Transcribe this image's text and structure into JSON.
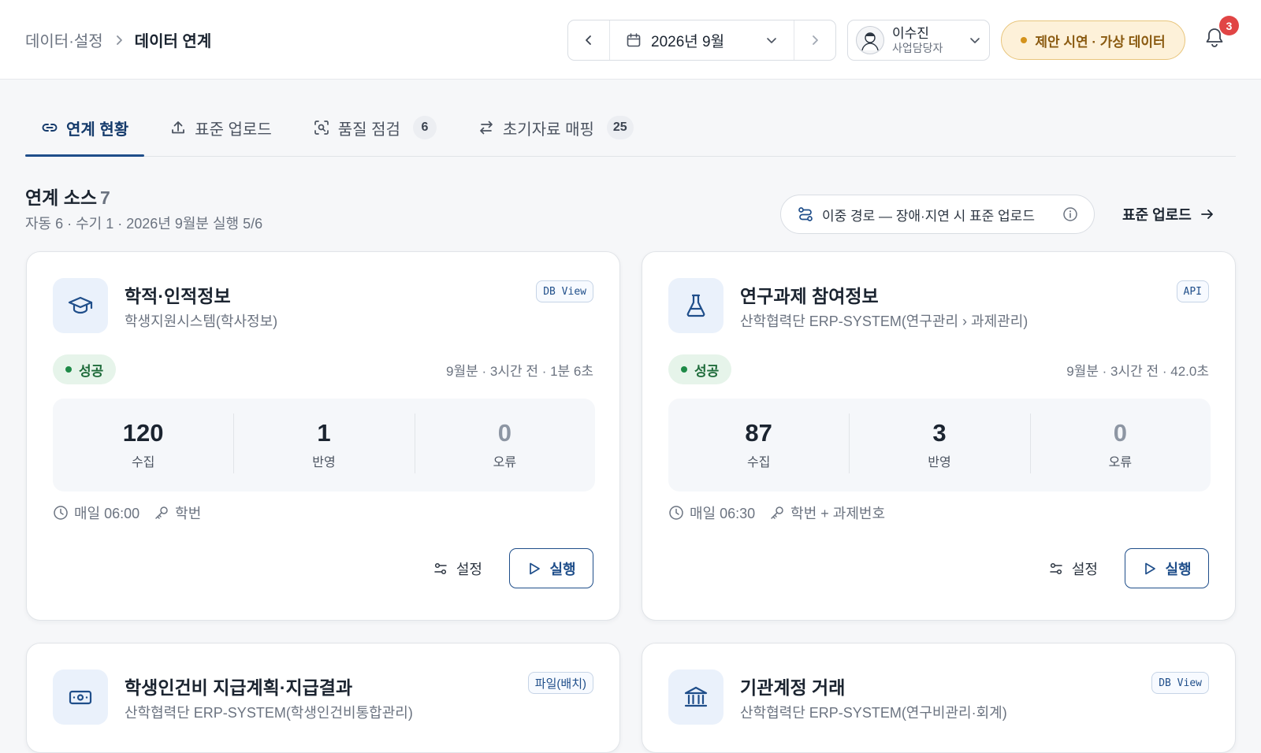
{
  "breadcrumb": {
    "parent": "데이터·설정",
    "current": "데이터 연계"
  },
  "period": {
    "value": "2026년 9월"
  },
  "user": {
    "name": "이수진",
    "role": "사업담당자"
  },
  "demo_badge": "제안 시연 · 가상 데이터",
  "notifications": {
    "count": "3"
  },
  "tabs": [
    {
      "label": "연계 현황",
      "count": "",
      "icon": "link-icon",
      "active": true
    },
    {
      "label": "표준 업로드",
      "count": "",
      "icon": "upload-icon",
      "active": false
    },
    {
      "label": "품질 점검",
      "count": "6",
      "icon": "scan-icon",
      "active": false
    },
    {
      "label": "초기자료 매핑",
      "count": "25",
      "icon": "swap-icon",
      "active": false
    }
  ],
  "section": {
    "title": "연계 소스",
    "count": "7",
    "subtitle": "자동 6 · 수기 1 · 2026년 9월분 실행 5/6",
    "route_note": "이중 경로 — 장애·지연 시 표준 업로드",
    "upload_link": "표준 업로드"
  },
  "cards": [
    {
      "title": "학적·인적정보",
      "system": "학생지원시스템(학사정보)",
      "type": "DB View",
      "icon": "graduation-cap-icon",
      "status": "성공",
      "run_info": "9월분 · 3시간 전 · 1분 6초",
      "stats": {
        "collected": "120",
        "collected_label": "수집",
        "applied": "1",
        "applied_label": "반영",
        "errors": "0",
        "errors_label": "오류"
      },
      "schedule": "매일 06:00",
      "key": "학번",
      "settings_label": "설정",
      "run_label": "실행"
    },
    {
      "title": "연구과제 참여정보",
      "system": "산학협력단 ERP-SYSTEM(연구관리 › 과제관리)",
      "type": "API",
      "icon": "flask-icon",
      "status": "성공",
      "run_info": "9월분 · 3시간 전 · 42.0초",
      "stats": {
        "collected": "87",
        "collected_label": "수집",
        "applied": "3",
        "applied_label": "반영",
        "errors": "0",
        "errors_label": "오류"
      },
      "schedule": "매일 06:30",
      "key": "학번 + 과제번호",
      "settings_label": "설정",
      "run_label": "실행"
    },
    {
      "title": "학생인건비 지급계획·지급결과",
      "system": "산학협력단 ERP-SYSTEM(학생인건비통합관리)",
      "type": "파일(배치)",
      "icon": "banknote-icon"
    },
    {
      "title": "기관계정 거래",
      "system": "산학협력단 ERP-SYSTEM(연구비관리·회계)",
      "type": "DB View",
      "icon": "bank-icon"
    }
  ]
}
